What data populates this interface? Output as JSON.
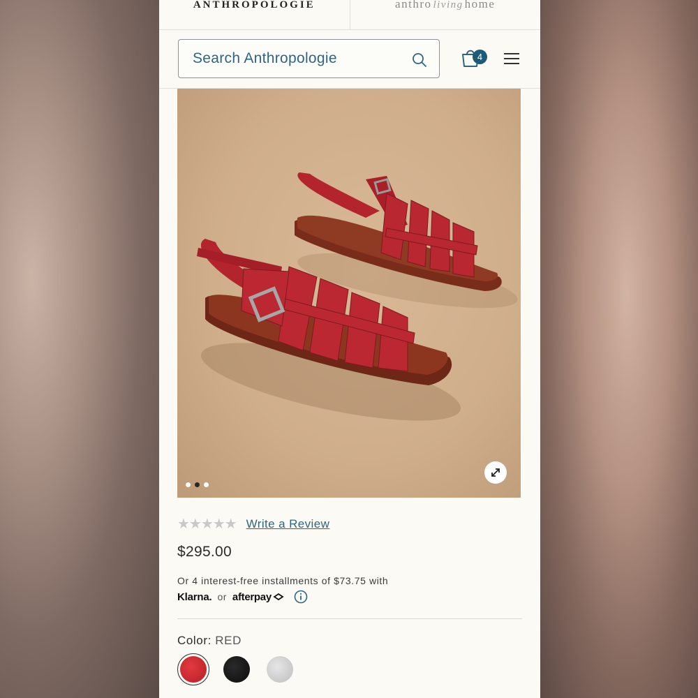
{
  "header": {
    "brand": "ANTHROPOLOGIE",
    "home_brand_left": "anthro",
    "home_brand_mid": "living",
    "home_brand_right": "home"
  },
  "search": {
    "placeholder": "Search Anthropologie"
  },
  "cart": {
    "count": "4"
  },
  "icons": {
    "search": "search-icon",
    "cart": "shopping-bag-icon",
    "menu": "hamburger-menu-icon",
    "expand": "expand-icon",
    "info": "info-icon"
  },
  "product": {
    "image_alt": "Red leather fisherman sandals",
    "carousel": {
      "count": 3,
      "active": 2
    },
    "rating_stars": "★★★★★",
    "write_review": "Write a Review",
    "price": "$295.00",
    "installments_text": "Or 4 interest-free installments of $73.75 with",
    "klarna": "Klarna.",
    "or": "or",
    "afterpay": "afterpay",
    "color_label": "Color:",
    "color_value": "RED",
    "swatches": [
      {
        "name": "red",
        "color": "#c8262c",
        "selected": true
      },
      {
        "name": "black",
        "color": "#111111",
        "selected": false
      },
      {
        "name": "silver",
        "color": "#d0d0d0",
        "selected": false
      }
    ]
  },
  "colors": {
    "accent": "#2d6683",
    "badge": "#1d5a76"
  }
}
